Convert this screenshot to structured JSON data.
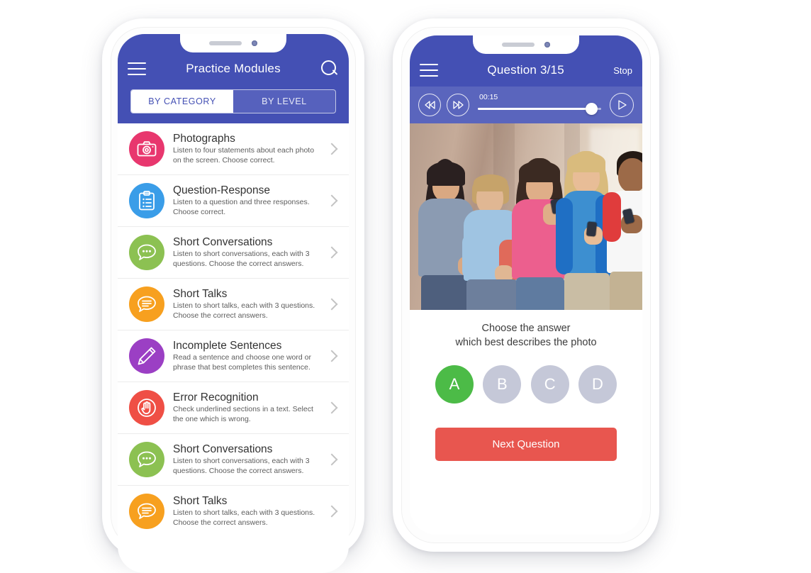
{
  "modules_phone": {
    "header": {
      "menu_icon": "hamburger-icon",
      "title": "Practice Modules",
      "search_icon": "search-icon"
    },
    "segmented": {
      "options": [
        "BY CATEGORY",
        "BY LEVEL"
      ],
      "selected": "BY CATEGORY"
    },
    "items": [
      {
        "title": "Photographs",
        "desc": "Listen to four statements about each photo on the screen. Choose correct.",
        "icon": "camera-icon",
        "color": "#e8376e"
      },
      {
        "title": "Question-Response",
        "desc": "Listen to a question and three responses. Choose correct.",
        "icon": "clipboard-icon",
        "color": "#3a9de8"
      },
      {
        "title": "Short Conversations",
        "desc": "Listen to short conversations, each with 3 questions. Choose the correct answers.",
        "icon": "chat-dots-icon",
        "color": "#8cc152"
      },
      {
        "title": "Short Talks",
        "desc": "Listen to short talks, each with 3 questions. Choose the correct answers.",
        "icon": "chat-lines-icon",
        "color": "#f7a01f"
      },
      {
        "title": "Incomplete Sentences",
        "desc": "Read a sentence and choose one word or phrase that best completes this sentence.",
        "icon": "pencil-icon",
        "color": "#9b3fc4"
      },
      {
        "title": "Error Recognition",
        "desc": "Check underlined sections in a text. Select the one which is wrong.",
        "icon": "hand-stop-icon",
        "color": "#ef4f45"
      },
      {
        "title": "Short Conversations",
        "desc": "Listen to short conversations, each with 3 questions. Choose the correct answers.",
        "icon": "chat-dots-icon",
        "color": "#8cc152"
      },
      {
        "title": "Short Talks",
        "desc": "Listen to short talks, each with 3 questions. Choose the correct answers.",
        "icon": "chat-lines-icon",
        "color": "#f7a01f"
      }
    ]
  },
  "question_phone": {
    "header": {
      "menu_icon": "hamburger-icon",
      "title": "Question 3/15",
      "stop_label": "Stop"
    },
    "player": {
      "rewind_icon": "rewind-icon",
      "forward_icon": "fast-forward-icon",
      "play_icon": "play-icon",
      "time": "00:15",
      "progress_percent": 92
    },
    "photo_alt": "five teenagers with smartphones leaning on a wall",
    "prompt_line1": "Choose the answer",
    "prompt_line2": "which best describes the photo",
    "answers": [
      {
        "label": "A",
        "selected": true
      },
      {
        "label": "B",
        "selected": false
      },
      {
        "label": "C",
        "selected": false
      },
      {
        "label": "D",
        "selected": false
      }
    ],
    "next_label": "Next Question"
  },
  "colors": {
    "appbar": "#4450b4",
    "player": "#5a65bd",
    "accent_green": "#4cbb47",
    "accent_red": "#e8564f",
    "answer_idle": "#c5c8d8"
  }
}
